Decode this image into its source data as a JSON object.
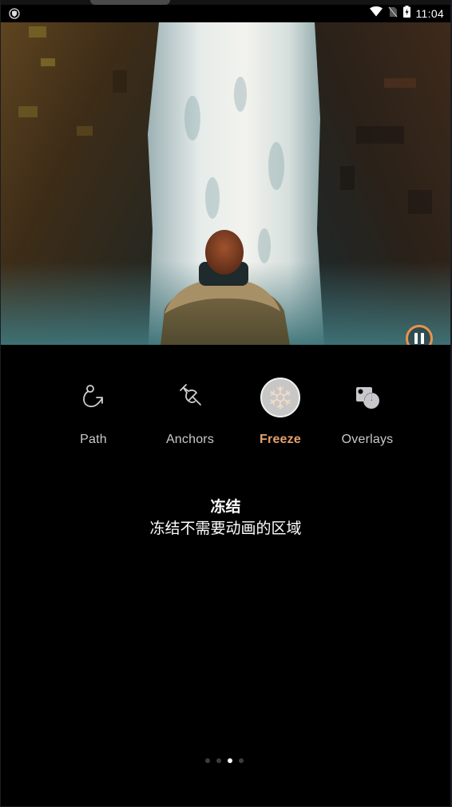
{
  "status_bar": {
    "left_icon": "shield-notification-icon",
    "wifi_icon": "wifi-icon",
    "signal_icon": "no-sim-signal-icon",
    "battery_icon": "battery-charging-icon",
    "time": "11:04"
  },
  "video": {
    "description": "waterfall-with-person-in-parka",
    "control_icon": "pause-icon",
    "accent_color": "#e8934f"
  },
  "tools": [
    {
      "label": "Path",
      "icon": "path-icon",
      "active": false
    },
    {
      "label": "Anchors",
      "icon": "pushpin-icon",
      "active": false
    },
    {
      "label": "Freeze",
      "icon": "snowflake-icon",
      "active": true
    },
    {
      "label": "Overlays",
      "icon": "overlays-icon",
      "active": false
    }
  ],
  "active_color": "#e6a06b",
  "description": {
    "title": "冻结",
    "subtitle": "冻结不需要动画的区域"
  },
  "pager": {
    "total": 4,
    "current": 3
  }
}
